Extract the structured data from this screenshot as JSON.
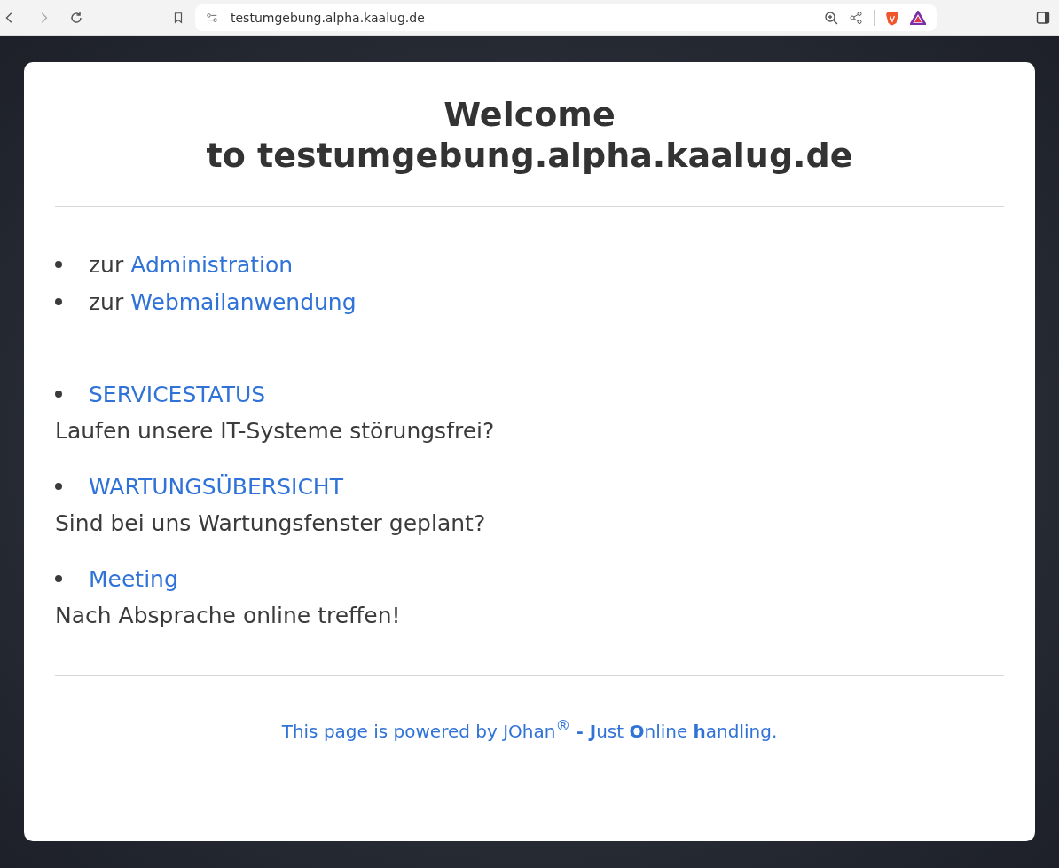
{
  "browser": {
    "url": "testumgebung.alpha.kaalug.de"
  },
  "heading": {
    "line_1": "Welcome",
    "line_2": "to testumgebung.alpha.kaalug.de"
  },
  "links": [
    {
      "prefix": "zur",
      "label": "Administration"
    },
    {
      "prefix": "zur",
      "label": "Webmailanwendung"
    }
  ],
  "services": [
    {
      "label": "SERVICESTATUS",
      "description": "Laufen unsere IT-Systeme störungsfrei?"
    },
    {
      "label": "WARTUNGSÜBERSICHT",
      "description": "Sind bei uns Wartungsfenster geplant?"
    },
    {
      "label": "Meeting",
      "description": "Nach Absprache online treffen!"
    }
  ],
  "footer": "This page is powered by JOhan$^{®}$ **- J**ust **O**nline **h**andling."
}
